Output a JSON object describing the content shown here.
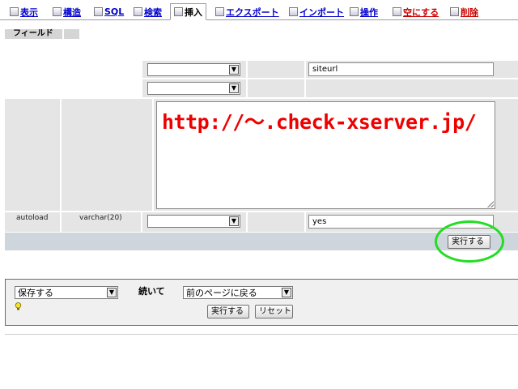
{
  "tabs": [
    {
      "label": "表示",
      "icon": "browse-icon"
    },
    {
      "label": "構造",
      "icon": "structure-icon"
    },
    {
      "label": "SQL",
      "icon": "sql-icon"
    },
    {
      "label": "検索",
      "icon": "search-icon"
    },
    {
      "label": "挿入",
      "icon": "insert-icon",
      "active": true
    },
    {
      "label": "エクスポート",
      "icon": "export-icon"
    },
    {
      "label": "インポート",
      "icon": "import-icon"
    },
    {
      "label": "操作",
      "icon": "operations-icon"
    },
    {
      "label": "空にする",
      "icon": "empty-icon"
    },
    {
      "label": "削除",
      "icon": "drop-icon"
    }
  ],
  "field_header": "フィールド",
  "rows": [
    {
      "function": "",
      "value": "siteurl"
    },
    {
      "function": "",
      "value": ""
    },
    {
      "textarea_value": "http://〜.check-xserver.jp/"
    },
    {
      "field": "autoload",
      "type": "varchar(20)",
      "function": "",
      "value": "yes"
    }
  ],
  "execute_button": "実行する",
  "bottom": {
    "save_select": "保存する",
    "continue_label": "続いて",
    "after_select": "前のページに戻る",
    "execute_button": "実行する",
    "reset_button": "リセット"
  },
  "colors": {
    "highlight_ring": "#22dd22",
    "url_text": "#ee0000"
  }
}
